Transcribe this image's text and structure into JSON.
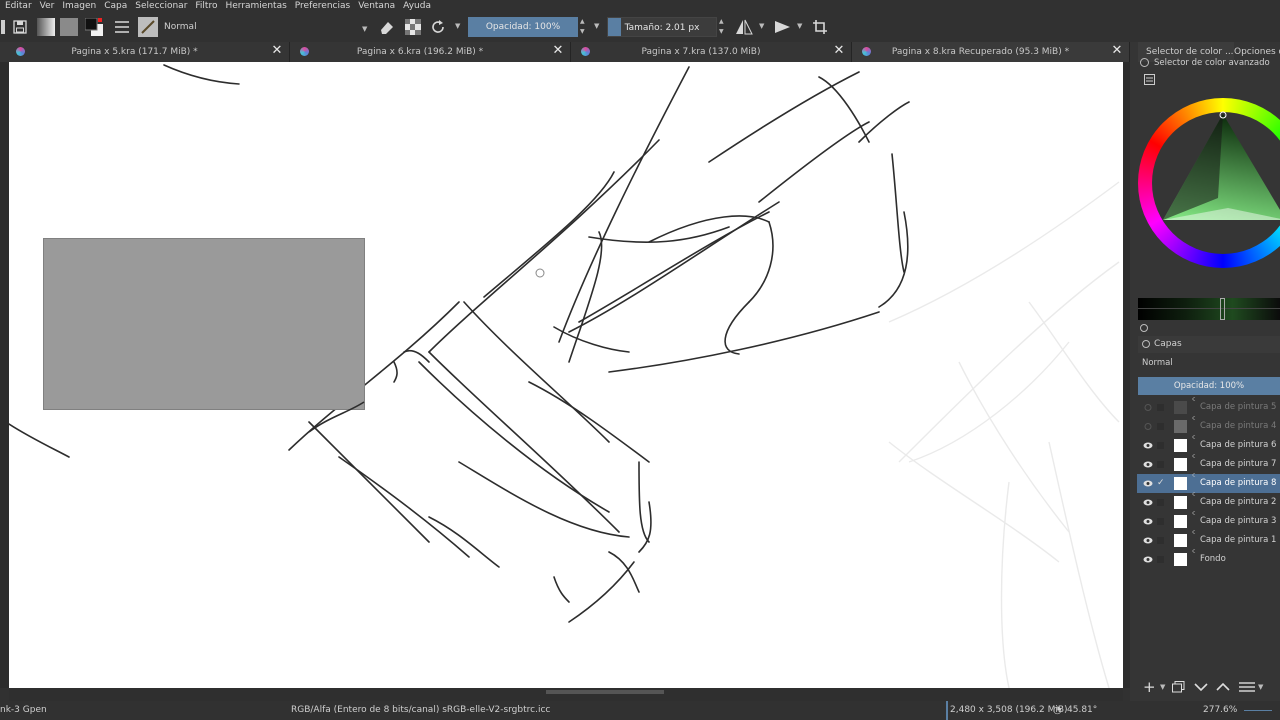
{
  "menu": [
    "Editar",
    "Ver",
    "Imagen",
    "Capa",
    "Seleccionar",
    "Filtro",
    "Herramientas",
    "Preferencias",
    "Ventana",
    "Ayuda"
  ],
  "toolbar": {
    "blend_mode": "Normal",
    "opacity_label": "Opacidad: 100%",
    "size_label": "Tamaño: 2.01 px"
  },
  "tabs": [
    {
      "label": "Pagina x 5.kra (171.7 MiB) *",
      "close": "✕"
    },
    {
      "label": "Pagina x 6.kra (196.2 MiB) *",
      "close": "✕"
    },
    {
      "label": "Pagina x 7.kra (137.0 MiB)",
      "close": "✕"
    },
    {
      "label": "Pagina x 8.kra Recuperado (95.3 MiB) *",
      "close": "✕"
    }
  ],
  "docker": {
    "tab_color": "Selector de color ...",
    "tab_options": "Opciones de",
    "advanced_selector": "Selector de color avanzado",
    "layers_title": "Capas",
    "layers_blend": "Normal",
    "layers_opacity": "Opacidad:  100%"
  },
  "layers": [
    {
      "name": "Capa de pintura 5",
      "visible": false,
      "active": false,
      "dim": true
    },
    {
      "name": "Capa de pintura 4",
      "visible": false,
      "active": false,
      "dim": true
    },
    {
      "name": "Capa de pintura 6",
      "visible": true,
      "active": false,
      "dim": false
    },
    {
      "name": "Capa de pintura 7",
      "visible": true,
      "active": false,
      "dim": false
    },
    {
      "name": "Capa de pintura 8",
      "visible": true,
      "active": true,
      "dim": false
    },
    {
      "name": "Capa de pintura 2",
      "visible": true,
      "active": false,
      "dim": false
    },
    {
      "name": "Capa de pintura 3",
      "visible": true,
      "active": false,
      "dim": false
    },
    {
      "name": "Capa de pintura 1",
      "visible": true,
      "active": false,
      "dim": false
    },
    {
      "name": "Fondo",
      "visible": true,
      "active": false,
      "dim": false
    }
  ],
  "status": {
    "brush": "nk-3 Gpen",
    "color_profile": "RGB/Alfa (Entero de 8 bits/canal)  sRGB-elle-V2-srgbtrc.icc",
    "dimensions": "2,480 x 3,508 (196.2 MiB)",
    "rotation": "45.81°",
    "zoom": "277.6%"
  },
  "colors": {
    "accent": "#5a7fa3",
    "active_layer": "#4d6f94",
    "canvas": "#ffffff"
  }
}
